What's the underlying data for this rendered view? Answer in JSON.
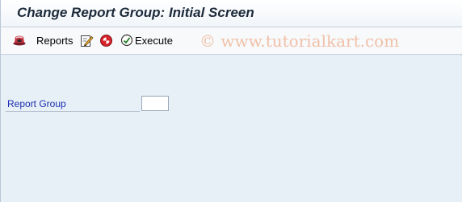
{
  "window": {
    "title": "Change Report Group: Initial Screen"
  },
  "toolbar": {
    "reports_label": "Reports",
    "execute_label": "Execute",
    "watermark": "© www.tutorialkart.com"
  },
  "form": {
    "report_group_label": "Report Group",
    "report_group_value": ""
  },
  "colors": {
    "field_label": "#1a2fb0",
    "background": "#e7eff7",
    "watermark": "#f1c0a8"
  },
  "icons": [
    "display-icon",
    "edit-icon",
    "delete-icon",
    "execute-icon"
  ]
}
